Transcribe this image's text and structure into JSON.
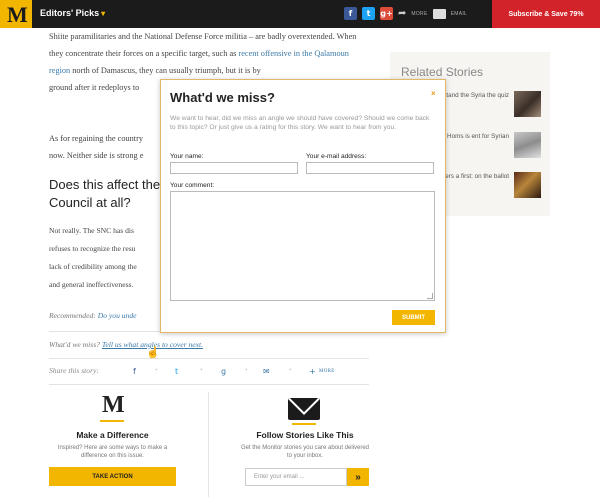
{
  "topbar": {
    "logo": "M",
    "editors_label": "Editors' Picks",
    "editors_caret": "▾",
    "share_more": "MORE",
    "email_label": "EMAIL",
    "subscribe_label": "Subscribe & Save 79%"
  },
  "article": {
    "p1_a": "Shiite paramilitaries and the National Defense Force militia – are badly overextended. When they concentrate their forces on a specific target, such as ",
    "p1_link": "recent offensive in the Qalamoun region",
    "p1_b": " north of Damascus, they can usually triumph, but it is by ",
    "p1_c": "ground after it redeploys to",
    "p2_a": "As for regaining the country",
    "p2_b": "now. Neither side is strong e",
    "heading_line1": "Does this affect the",
    "heading_line2": "Council at all?",
    "p3_l1": "Not really. The SNC has dis",
    "p3_l2": "refuses to recognize the resu",
    "p3_l3": "lack of credibility among the",
    "p3_l4": "and general ineffectiveness.",
    "recommended_label": "Recommended:",
    "recommended_link": "Do you unde",
    "miss_text": "What'd we miss?",
    "miss_link": "Tell us what angles to cover next.",
    "share_label": "Share this story:",
    "share_more": "MORE"
  },
  "related": {
    "title": "Related Stories",
    "items": [
      {
        "text": "stand the Syria the quiz"
      },
      {
        "text": "ion of Homs is ent for Syrian"
      },
      {
        "text": "ian voters a first: on the ballot"
      }
    ]
  },
  "bottom": {
    "logo": "M",
    "left_title": "Make a Difference",
    "left_desc": "Inspired? Here are some ways to make a difference on this issue.",
    "take_action": "TAKE ACTION",
    "right_title": "Follow Stories Like This",
    "right_desc": "Get the Monitor stories you care about delivered to your inbox.",
    "email_placeholder": "Enter your email ...",
    "go_label": "»"
  },
  "modal": {
    "title": "What'd we miss?",
    "close": "×",
    "description": "We want to hear, did we miss an angle we should have covered? Should we come back to this topic? Or just give us a rating for this story. We want to hear from you.",
    "name_label": "Your name:",
    "email_label": "Your e-mail address:",
    "comment_label": "Your comment:",
    "submit_label": "SUBMIT"
  },
  "colors": {
    "accent": "#f2b600",
    "subscribe": "#d2232a",
    "link": "#3c7aa8"
  }
}
